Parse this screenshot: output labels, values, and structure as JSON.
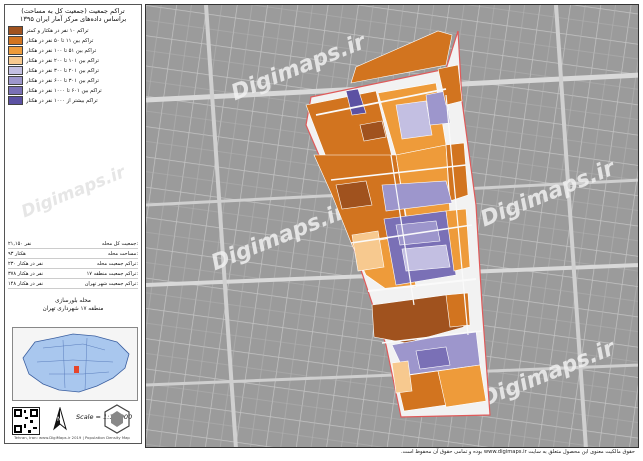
{
  "legend": {
    "title_line1": "تراکم جمعیت (جمعیت کل به مساحت)",
    "title_line2": "براساس داده‌های مرکز آمار ایران ۱۳۹۵",
    "items": [
      {
        "label": "تراکم ۱۰ نفر در هکتار و کمتر",
        "color": "#a0521e"
      },
      {
        "label": "تراکم بین ۱۱ تا ۵۰ نفر در هکتار",
        "color": "#d2741f"
      },
      {
        "label": "تراکم بین ۵۱ تا ۱۰۰ نفر در هکتار",
        "color": "#ee9b3a"
      },
      {
        "label": "تراکم بین ۱۰۱ تا ۲۰۰ نفر در هکتار",
        "color": "#f7c98f"
      },
      {
        "label": "تراکم بین ۲۰۱ تا ۳۰۰ نفر در هکتار",
        "color": "#c3bfe2"
      },
      {
        "label": "تراکم بین ۳۰۱ تا ۶۰۰ نفر در هکتار",
        "color": "#9d96cc"
      },
      {
        "label": "تراکم بین ۶۰۱ تا ۱۰۰۰ نفر در هکتار",
        "color": "#7a70b6"
      },
      {
        "label": "تراکم بیشتر از ۱۰۰۰ نفر در هکتار",
        "color": "#5c51a3"
      }
    ]
  },
  "stats": [
    {
      "label": "جمعیت کل محله:",
      "value": "۲۱,۱۵۰ نفر"
    },
    {
      "label": "مساحت محله:",
      "value": "۹۳ هکتار"
    },
    {
      "label": "تراکم جمعیت محله:",
      "value": "۲۳۰ نفر در هکتار"
    },
    {
      "label": "تراکم جمعیت منطقه ۱۷:",
      "value": "۳۷۸ نفر در هکتار"
    },
    {
      "label": "تراکم جمعیت شهر تهران:",
      "value": "۱۴۸ نفر در هکتار"
    }
  ],
  "area": {
    "line1": "محله بلورسازی",
    "line2": "منطقه ۱۷ شهرداری تهران"
  },
  "scale": "Scale = 1:10,000",
  "credit": "Tehran, Iran: www.DigiMaps.ir 2019 | Population Density Map",
  "watermark": "Digimaps.ir",
  "footer_line1": "حقوق مالکیت معنوی این محصول متعلق به سایت www.digimaps.ir بوده و تمامی حقوق آن محفوظ است.",
  "colors": {
    "map_background": "#9e9e9e",
    "street": "#d9d9d9",
    "boundary": "#e05a5a"
  },
  "icons": [
    "qr-code-icon",
    "north-arrow-icon",
    "digimaps-logo-icon"
  ]
}
